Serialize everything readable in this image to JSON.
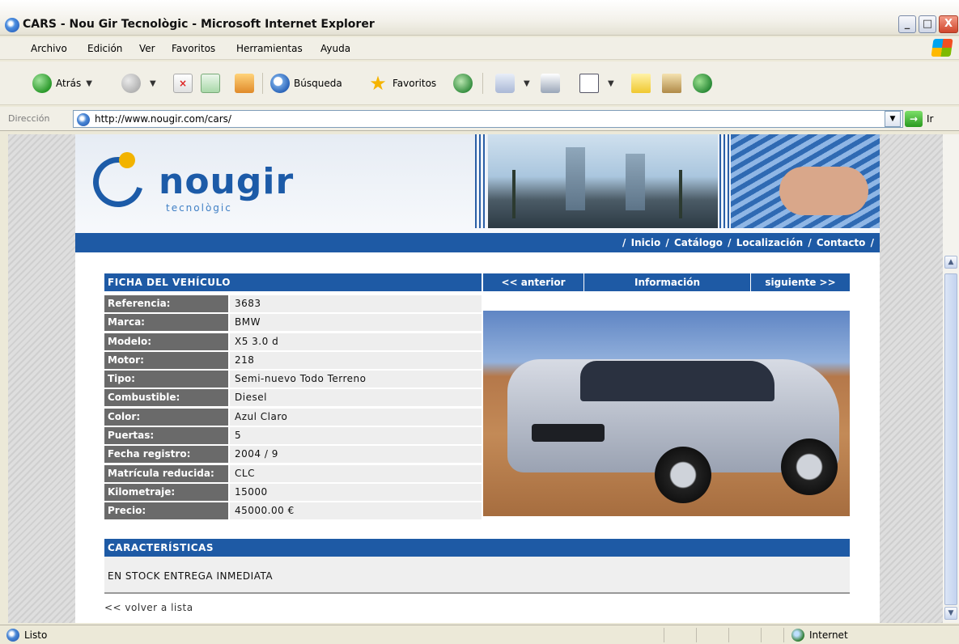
{
  "window": {
    "title": "CARS - Nou Gir Tecnològic - Microsoft Internet Explorer",
    "minimize_label": "_",
    "maximize_label": "□",
    "close_label": "X"
  },
  "menu": [
    "Archivo",
    "Edición",
    "Ver",
    "Favoritos",
    "Herramientas",
    "Ayuda"
  ],
  "toolbar": {
    "back_label": "Atrás",
    "search_label": "Búsqueda",
    "favorites_label": "Favoritos"
  },
  "address": {
    "label": "Dirección",
    "url": "http://www.nougir.com/cars/",
    "go_label": "Ir"
  },
  "site": {
    "logo_text": "nougir",
    "logo_sub": "tecnològic",
    "nav_links": [
      "Inicio",
      "Catálogo",
      "Localización",
      "Contacto"
    ],
    "nav_separator": "/"
  },
  "vehicle": {
    "sheet_title": "FICHA DEL VEHÍCULO",
    "prev_label": "<< anterior",
    "info_label": "Información",
    "next_label": "siguiente >>",
    "specs": [
      {
        "label": "Referencia:",
        "value": "3683"
      },
      {
        "label": "Marca:",
        "value": "BMW"
      },
      {
        "label": "Modelo:",
        "value": "X5 3.0 d"
      },
      {
        "label": "Motor:",
        "value": "218"
      },
      {
        "label": "Tipo:",
        "value": "Semi-nuevo Todo Terreno"
      },
      {
        "label": "Combustible:",
        "value": "Diesel"
      },
      {
        "label": "Color:",
        "value": "Azul Claro"
      },
      {
        "label": "Puertas:",
        "value": "5"
      },
      {
        "label": "Fecha registro:",
        "value": "2004 / 9"
      },
      {
        "label": "Matrícula reducida:",
        "value": "CLC"
      },
      {
        "label": "Kilometraje:",
        "value": "15000"
      },
      {
        "label": "Precio:",
        "value": "45000.00 €"
      }
    ],
    "features_title": "CARACTERÍSTICAS",
    "features_text": "EN STOCK ENTREGA INMEDIATA",
    "back_to_list": "<< volver a lista"
  },
  "status": {
    "text": "Listo",
    "zone": "Internet"
  }
}
